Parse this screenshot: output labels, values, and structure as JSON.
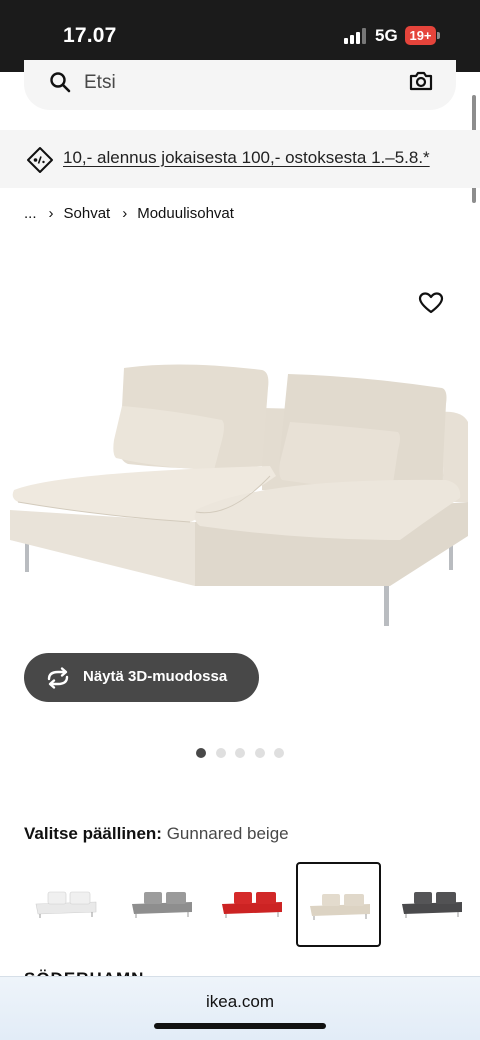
{
  "status_bar": {
    "time": "17.07",
    "network": "5G",
    "battery": "19+"
  },
  "search": {
    "placeholder": "Etsi",
    "icon": "search-icon",
    "camera_icon": "camera-icon"
  },
  "promo": {
    "text": "10,- alennus jokaisesta 100,- ostoksesta 1.–5.8.*",
    "icon": "price-tag-icon"
  },
  "breadcrumb": {
    "items": [
      "...",
      "Sohvat",
      "Moduulisohvat"
    ]
  },
  "product": {
    "image_alt": "sofa-module-beige",
    "favorite_icon": "heart-icon",
    "view_3d_label": "Näytä 3D-muodossa",
    "carousel": {
      "total": 5,
      "active": 1
    }
  },
  "cover": {
    "label": "Valitse päällinen:",
    "selected_value": "Gunnared beige",
    "swatches": [
      {
        "color": "#ececec",
        "selected": false
      },
      {
        "color": "#8e8e8e",
        "selected": false
      },
      {
        "color": "#cc2323",
        "selected": false
      },
      {
        "color": "#dcd3c3",
        "selected": true
      },
      {
        "color": "#4a4a4c",
        "selected": false
      }
    ]
  },
  "cut_heading": "SÖDERHAMN",
  "browser": {
    "url": "ikea.com"
  },
  "colors": {
    "status_bar_bg": "#1b1b1b",
    "button_bg": "#484848",
    "battery": "#e5443b",
    "sofa_fabric": "#e5ddd0"
  }
}
